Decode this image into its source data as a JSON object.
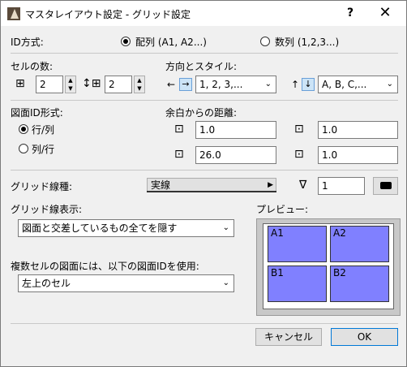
{
  "window": {
    "title": "マスタレイアウト設定 - グリッド設定",
    "help": "?",
    "close": "✕"
  },
  "id_method": {
    "label": "ID方式:",
    "options": [
      "配列 (A1, A2...)",
      "数列 (1,2,3...)"
    ],
    "selected": "配列 (A1, A2...)"
  },
  "cell_count": {
    "label": "セルの数:",
    "columns": "2",
    "rows": "2"
  },
  "direction_style": {
    "label": "方向とスタイル:",
    "horizontal_style": "1, 2, 3,...",
    "vertical_style": "A, B, C,..."
  },
  "drawing_id_format": {
    "label": "図面ID形式:",
    "options": [
      "行/列",
      "列/行"
    ],
    "selected": "行/列"
  },
  "margins": {
    "label": "余白からの距離:",
    "top": "1.0",
    "left": "1.0",
    "bottom": "26.0",
    "right": "1.0"
  },
  "grid_line_type": {
    "label": "グリッド線種:",
    "value": "実線",
    "pen_value": "1"
  },
  "grid_line_display": {
    "label": "グリッド線表示:",
    "value": "図面と交差しているもの全てを隠す"
  },
  "multi_cell": {
    "label": "複数セルの図面には、以下の図面IDを使用:",
    "value": "左上のセル"
  },
  "preview": {
    "label": "プレビュー:",
    "cells": [
      "A1",
      "A2",
      "B1",
      "B2"
    ],
    "cell_color": "#8080ff"
  },
  "buttons": {
    "cancel": "キャンセル",
    "ok": "OK"
  }
}
